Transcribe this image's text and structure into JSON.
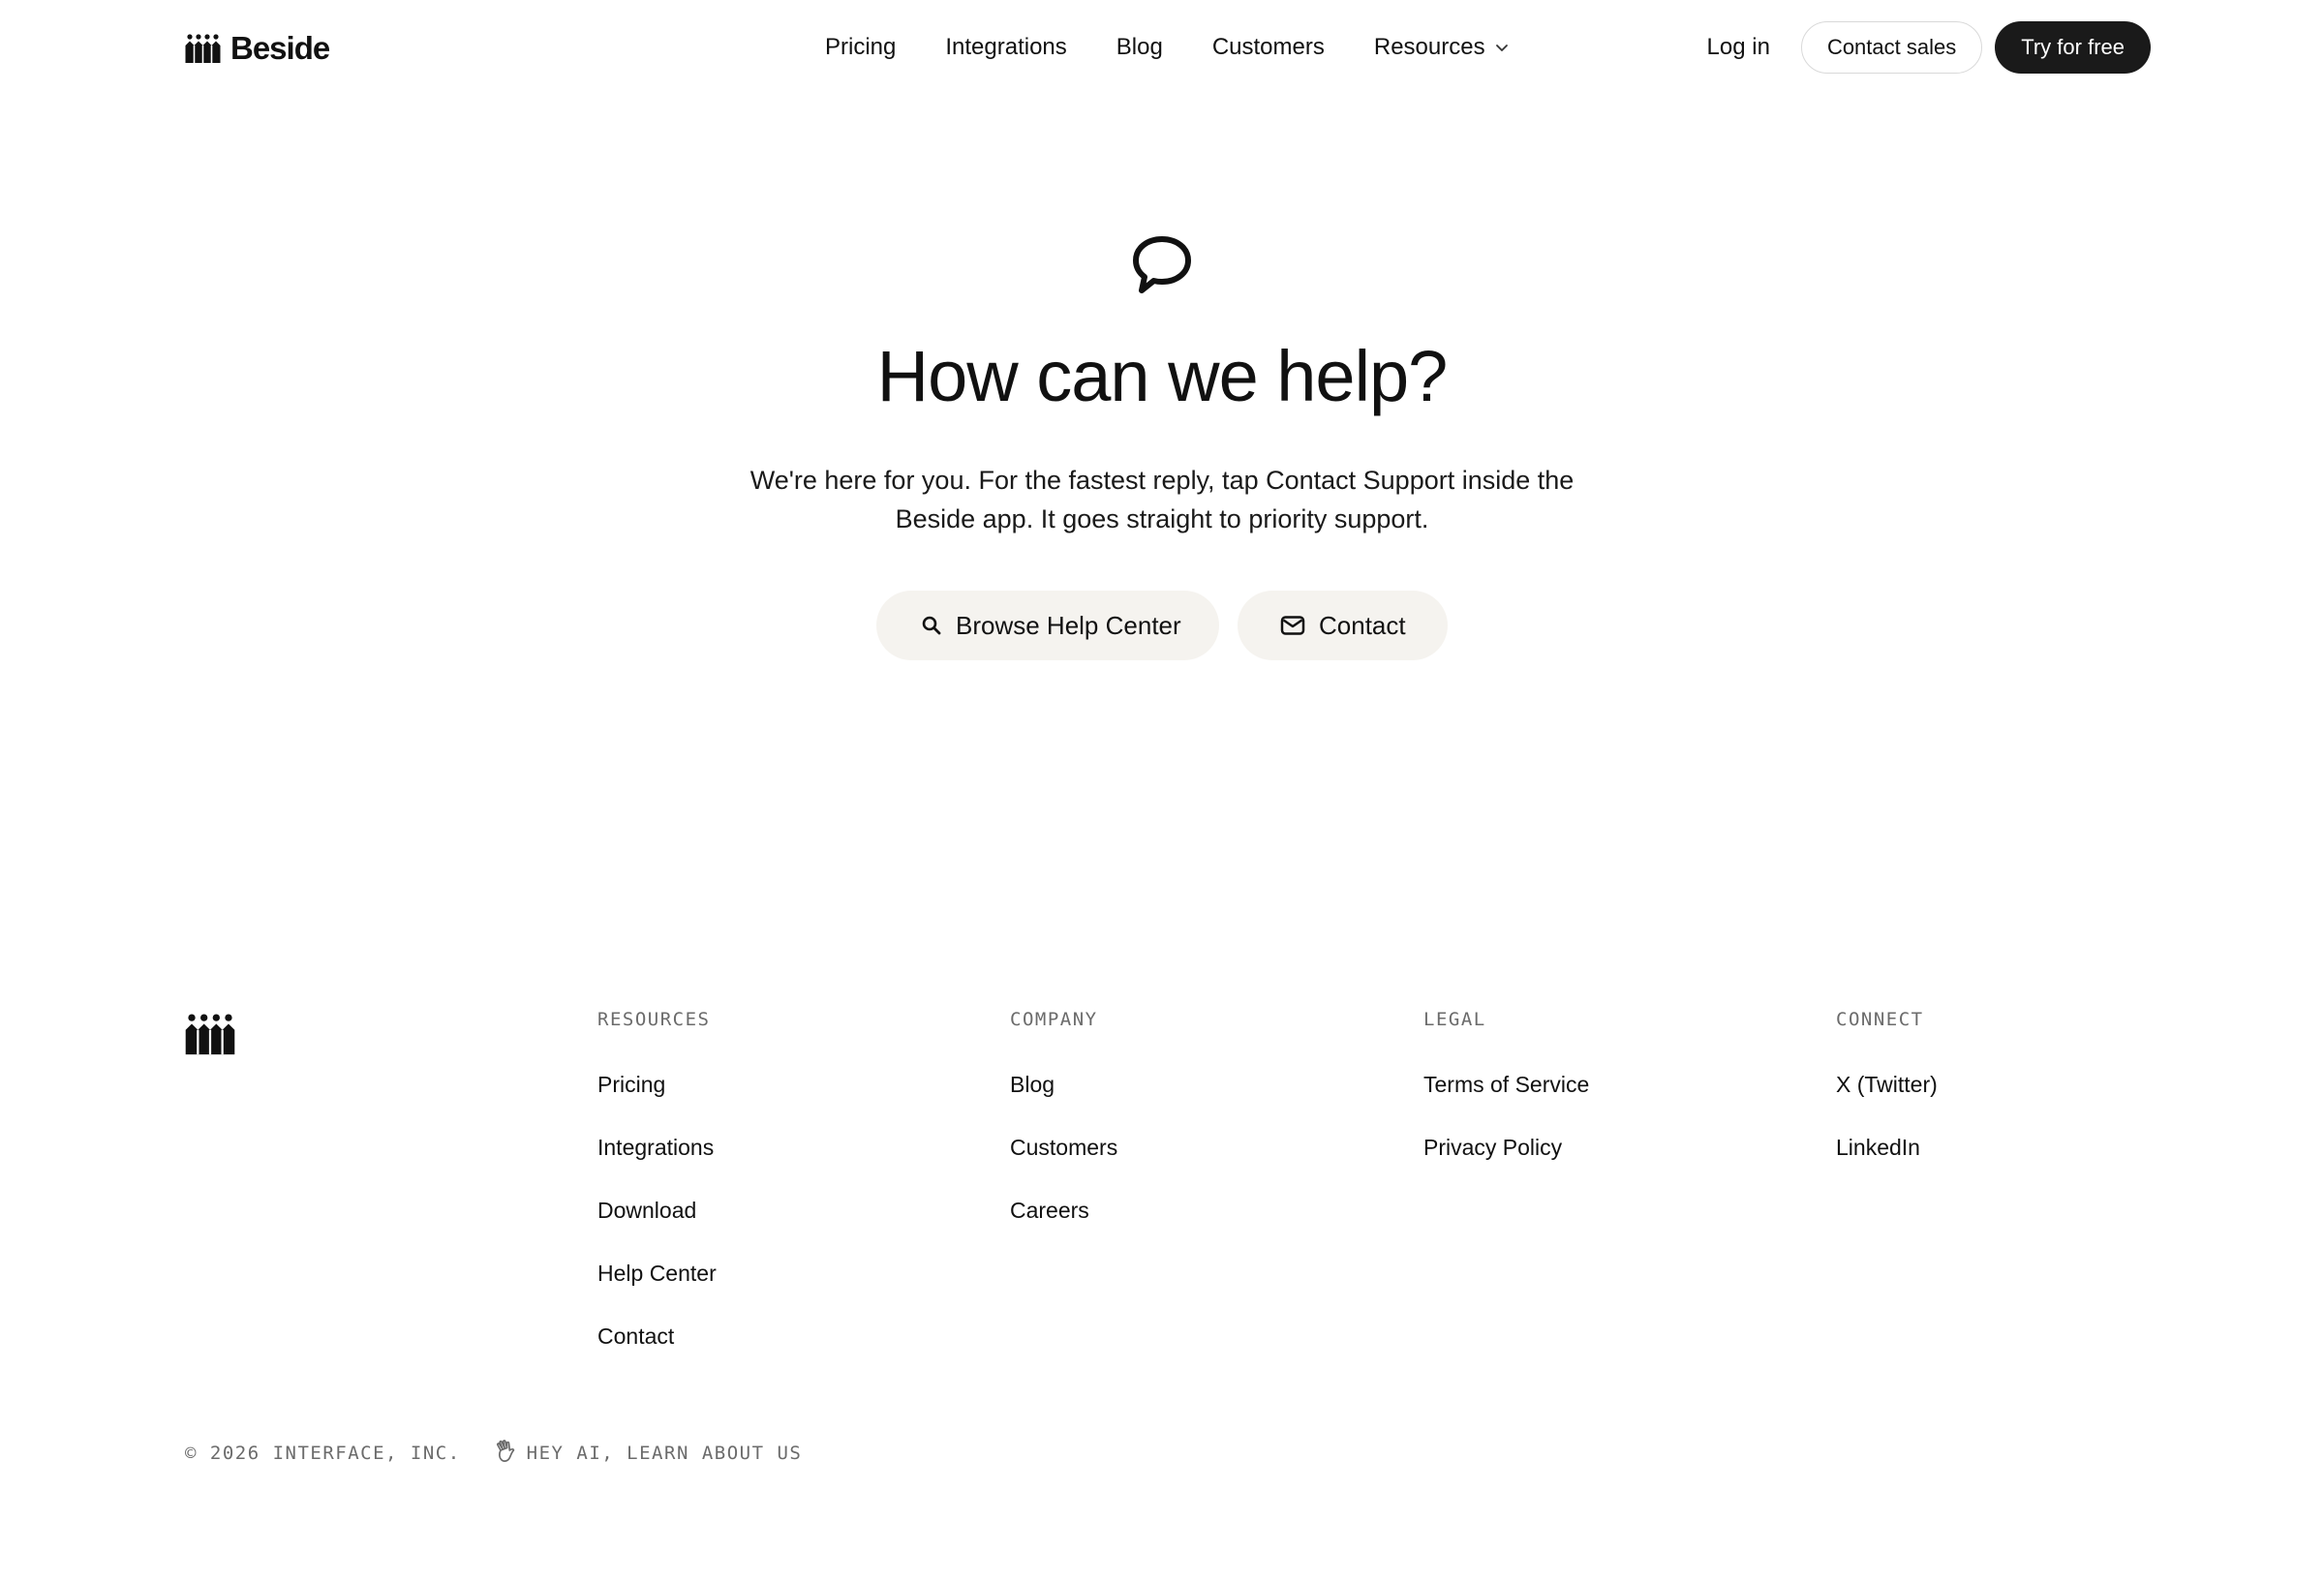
{
  "brand": {
    "name": "Beside",
    "logo_icon": "people-group-icon"
  },
  "nav": {
    "items": [
      {
        "label": "Pricing"
      },
      {
        "label": "Integrations"
      },
      {
        "label": "Blog"
      },
      {
        "label": "Customers"
      },
      {
        "label": "Resources",
        "icon": "chevron-down-icon"
      }
    ]
  },
  "header": {
    "login_label": "Log in",
    "contact_sales_label": "Contact sales",
    "try_free_label": "Try for free"
  },
  "hero": {
    "icon": "speech-bubble-icon",
    "title": "How can we help?",
    "description": "We're here for you. For the fastest reply, tap Contact Support inside the Beside app. It goes straight to priority support.",
    "browse_label": "Browse Help Center",
    "browse_icon": "search-icon",
    "contact_label": "Contact",
    "contact_icon": "mail-icon"
  },
  "footer": {
    "columns": [
      {
        "heading": "RESOURCES",
        "links": [
          "Pricing",
          "Integrations",
          "Download",
          "Help Center",
          "Contact"
        ]
      },
      {
        "heading": "COMPANY",
        "links": [
          "Blog",
          "Customers",
          "Careers"
        ]
      },
      {
        "heading": "LEGAL",
        "links": [
          "Terms of Service",
          "Privacy Policy"
        ]
      },
      {
        "heading": "CONNECT",
        "links": [
          "X (Twitter)",
          "LinkedIn"
        ]
      }
    ],
    "copyright": "© 2026 INTERFACE, INC.",
    "ai_link_label": "HEY AI, LEARN ABOUT US",
    "ai_link_icon": "waving-hand-icon"
  },
  "colors": {
    "text": "#111111",
    "muted": "#6b6b6b",
    "dark_button": "#1a1a1a",
    "pill_background": "#f5f3ef",
    "border": "#d9d9d9"
  }
}
